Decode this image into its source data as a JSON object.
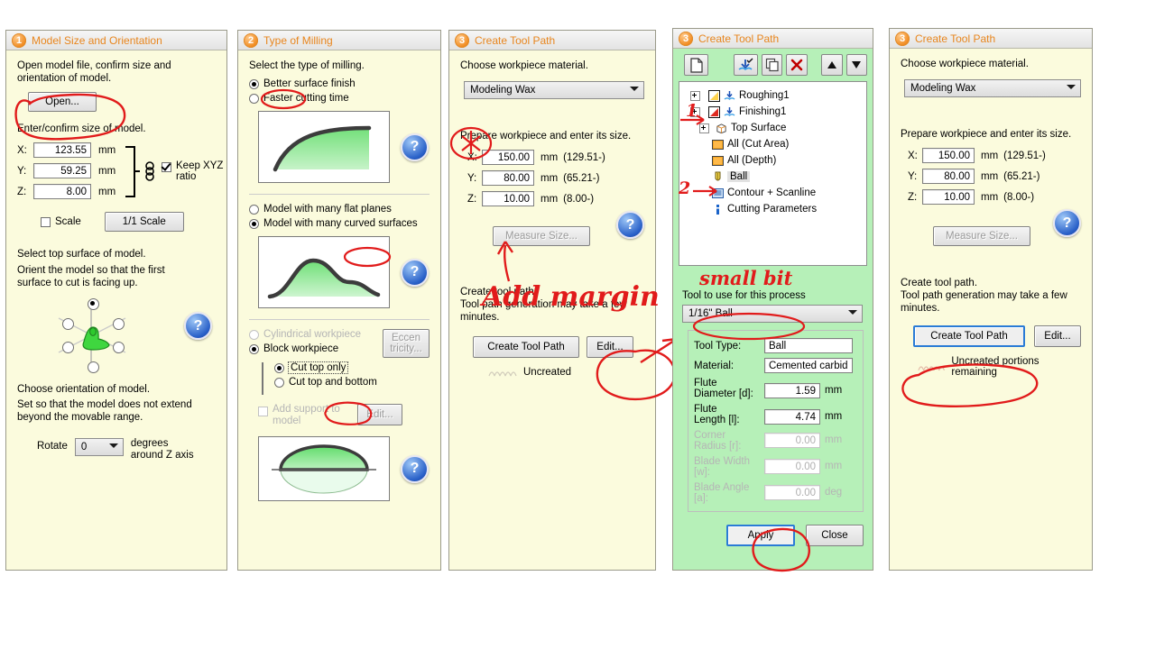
{
  "panel1": {
    "number": "1",
    "title": "Model Size and Orientation",
    "intro": "Open model file, confirm size and orientation of model.",
    "open_button": "Open...",
    "size_prompt": "Enter/confirm size of model.",
    "axes": [
      {
        "label": "X:",
        "value": "123.55",
        "unit": "mm"
      },
      {
        "label": "Y:",
        "value": "59.25",
        "unit": "mm"
      },
      {
        "label": "Z:",
        "value": "8.00",
        "unit": "mm"
      }
    ],
    "keep_ratio_label": "Keep XYZ ratio",
    "keep_ratio_checked": true,
    "scale_label": "Scale",
    "scale_checked": false,
    "scale_button": "1/1 Scale",
    "top_surface_prompt": "Select top surface of model.",
    "orient_hint": "Orient the model so that the first surface to cut is facing up.",
    "orientation_prompt": "Choose orientation of model.",
    "orientation_hint": "Set so that the model does not extend beyond the movable range.",
    "rotate_label": "Rotate",
    "rotate_value": "0",
    "rotate_unit_line1": "degrees",
    "rotate_unit_line2": "around Z axis",
    "help": "?"
  },
  "panel2": {
    "number": "2",
    "title": "Type of Milling",
    "prompt": "Select the type of milling.",
    "finish_options": [
      {
        "label": "Better surface finish",
        "selected": true
      },
      {
        "label": "Faster cutting time",
        "selected": false
      }
    ],
    "model_options": [
      {
        "label": "Model with many flat planes",
        "selected": false
      },
      {
        "label": "Model with many curved surfaces",
        "selected": true
      }
    ],
    "workpiece_options": [
      {
        "label": "Cylindrical workpiece",
        "selected": false,
        "disabled": true
      },
      {
        "label": "Block workpiece",
        "selected": true,
        "disabled": false
      }
    ],
    "cut_options": [
      {
        "label": "Cut top only",
        "selected": true
      },
      {
        "label": "Cut top and bottom",
        "selected": false
      }
    ],
    "eccentricity_button_line1": "Eccen",
    "eccentricity_button_line2": "tricity...",
    "support_label": "Add support to model",
    "support_checked": false,
    "support_edit_button": "Edit...",
    "help": "?"
  },
  "panel3": {
    "number": "3",
    "title": "Create Tool Path",
    "material_prompt": "Choose workpiece material.",
    "material_value": "Modeling Wax",
    "size_prompt": "Prepare workpiece and enter its size.",
    "axes": [
      {
        "label": "X:",
        "value": "150.00",
        "unit": "mm",
        "range": "(129.51-)"
      },
      {
        "label": "Y:",
        "value": "80.00",
        "unit": "mm",
        "range": "(65.21-)"
      },
      {
        "label": "Z:",
        "value": "10.00",
        "unit": "mm",
        "range": "(8.00-)"
      }
    ],
    "measure_button": "Measure Size...",
    "create_line1": "Create tool path.",
    "create_line2": "Tool path generation may take a few minutes.",
    "create_button": "Create Tool Path",
    "edit_button": "Edit...",
    "status": "Uncreated",
    "help": "?"
  },
  "panel4": {
    "number": "3",
    "title": "Create Tool Path",
    "toolbar_icons": [
      "new-document-icon",
      "insert-icon",
      "copy-icon",
      "delete-icon",
      "move-up-icon",
      "move-down-icon"
    ],
    "tree": [
      {
        "label": "Roughing1",
        "depth": 0,
        "expander": true,
        "icon": "roughing-icon",
        "selected": false
      },
      {
        "label": "Finishing1",
        "depth": 0,
        "expander": true,
        "icon": "finishing-icon",
        "selected": false
      },
      {
        "label": "Top Surface",
        "depth": 1,
        "expander": true,
        "icon": "surface-icon",
        "selected": false
      },
      {
        "label": "All (Cut Area)",
        "depth": 1,
        "expander": false,
        "icon": "cut-area-icon",
        "selected": false
      },
      {
        "label": "All (Depth)",
        "depth": 1,
        "expander": false,
        "icon": "depth-icon",
        "selected": false
      },
      {
        "label": "Ball",
        "depth": 1,
        "expander": false,
        "icon": "tool-icon",
        "selected": true
      },
      {
        "label": "Contour + Scanline",
        "depth": 1,
        "expander": false,
        "icon": "scanline-icon",
        "selected": false
      },
      {
        "label": "Cutting Parameters",
        "depth": 1,
        "expander": false,
        "icon": "parameters-icon",
        "selected": false
      }
    ],
    "tool_prompt": "Tool to use for this process",
    "tool_value": "1/16\" Ball",
    "fields": [
      {
        "label": "Tool Type:",
        "value": "Ball",
        "unit": "",
        "align": "left",
        "disabled": false
      },
      {
        "label": "Material:",
        "value": "Cemented carbide",
        "unit": "",
        "align": "left",
        "disabled": false
      },
      {
        "label": "Flute Diameter [d]:",
        "value": "1.59",
        "unit": "mm",
        "align": "right",
        "disabled": false
      },
      {
        "label": "Flute Length [l]:",
        "value": "4.74",
        "unit": "mm",
        "align": "right",
        "disabled": false
      },
      {
        "label": "Corner Radius [r]:",
        "value": "0.00",
        "unit": "mm",
        "align": "right",
        "disabled": true
      },
      {
        "label": "Blade Width [w]:",
        "value": "0.00",
        "unit": "mm",
        "align": "right",
        "disabled": true
      },
      {
        "label": "Blade Angle [a]:",
        "value": "0.00",
        "unit": "deg",
        "align": "right",
        "disabled": true
      }
    ],
    "apply_button": "Apply",
    "close_button": "Close"
  },
  "panel5": {
    "number": "3",
    "title": "Create Tool Path",
    "material_prompt": "Choose workpiece material.",
    "material_value": "Modeling Wax",
    "size_prompt": "Prepare workpiece and enter its size.",
    "axes": [
      {
        "label": "X:",
        "value": "150.00",
        "unit": "mm",
        "range": "(129.51-)"
      },
      {
        "label": "Y:",
        "value": "80.00",
        "unit": "mm",
        "range": "(65.21-)"
      },
      {
        "label": "Z:",
        "value": "10.00",
        "unit": "mm",
        "range": "(8.00-)"
      }
    ],
    "measure_button": "Measure Size...",
    "create_line1": "Create tool path.",
    "create_line2": "Tool path generation may take a few minutes.",
    "create_button": "Create Tool Path",
    "edit_button": "Edit...",
    "status": "Uncreated portions remaining",
    "help": "?"
  },
  "annotations": {
    "add_margin": "Add margin",
    "small_bit": "small bit",
    "step1": "1",
    "step2": "2",
    "color": "#e11b1b"
  }
}
